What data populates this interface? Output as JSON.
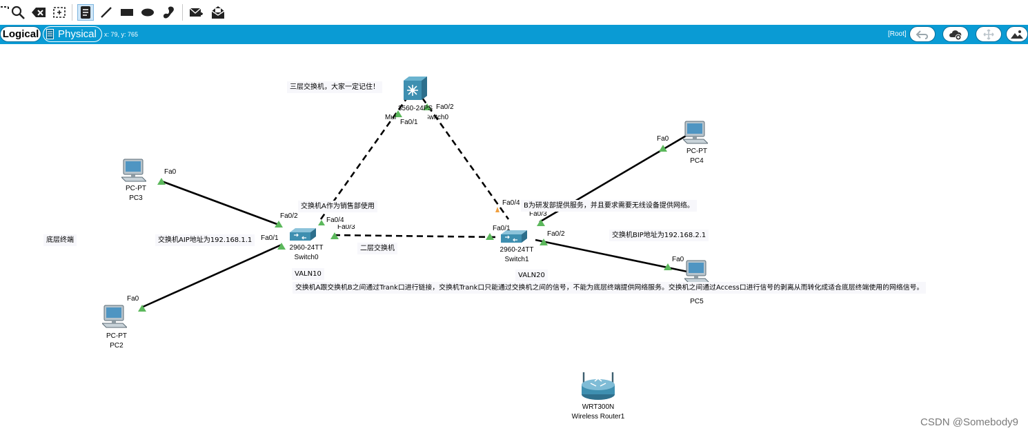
{
  "toolbar": {
    "tools": [
      "select-icon",
      "zoom-icon",
      "delete-icon",
      "resize-icon",
      "note-icon",
      "line-icon",
      "rectangle-icon",
      "ellipse-icon",
      "freeform-icon",
      "add-simple-pdu-icon",
      "add-complex-pdu-icon"
    ]
  },
  "workspace_bar": {
    "logical_label": "Logical",
    "physical_label": "Physical",
    "coords": "x: 79, y: 765",
    "root_label": "[Root]",
    "right_buttons": [
      "back-icon",
      "cluster-icon",
      "move-icon",
      "background-image-icon"
    ]
  },
  "devices": {
    "multilayer": {
      "model": "3560-24PS",
      "name_visible": "Switch0",
      "partial_label": "Mul"
    },
    "switch0": {
      "model": "2960-24TT",
      "name": "Switch0"
    },
    "switch1": {
      "model": "2960-24TT",
      "name": "Switch1"
    },
    "pc3": {
      "model": "PC-PT",
      "name": "PC3"
    },
    "pc2": {
      "model": "PC-PT",
      "name": "PC2"
    },
    "pc4": {
      "model": "PC-PT",
      "name": "PC4"
    },
    "pc5": {
      "name": "PC5"
    },
    "router": {
      "model": "WRT300N",
      "name": "Wireless Router1"
    }
  },
  "ports": {
    "ml_fa01": "Fa0/1",
    "ml_fa02": "Fa0/2",
    "pc3_fa0": "Fa0",
    "pc2_fa0": "Fa0",
    "pc4_fa0": "Fa0",
    "pc5_fa0": "Fa0",
    "sw0_fa02": "Fa0/2",
    "sw0_fa01": "Fa0/1",
    "sw0_fa04": "Fa0/4",
    "sw0_fa03": "Fa0/3",
    "sw1_fa04": "Fa0/4",
    "sw1_fa03": "Fa0/3",
    "sw1_fa01": "Fa0/1",
    "sw1_fa02": "Fa0/2"
  },
  "notes": {
    "l3_switch": "三层交换机，大家一定记住！",
    "switch_a_use": "交换机A作为销售部使用",
    "switch_a_ip": "交换机AIP地址为192.168.1.1",
    "bottom_terminal": "底层终端",
    "l2_switch": "二层交换机",
    "switch_b_use": "B为研发部提供服务，并且要求需要无线设备提供网络。",
    "switch_b_ip": "交换机BIP地址为192.168.2.1",
    "vlan10": "VALN10",
    "vlan20": "VALN20",
    "trunk_explain": "交换机A跟交换机B之间通过Trank口进行链接，交换机Trank口只能通过交换机之间的信号，不能为底层终端提供网络服务。交换机之间通过Access口进行信号的剥离从而转化成适合底层终端使用的网络信号。"
  },
  "watermark": "CSDN @Somebody9",
  "colors": {
    "bar": "#0a9bd4",
    "link_up": "#5cb85c",
    "link_line": "#000000",
    "note_bg": "#f7f7fb"
  }
}
